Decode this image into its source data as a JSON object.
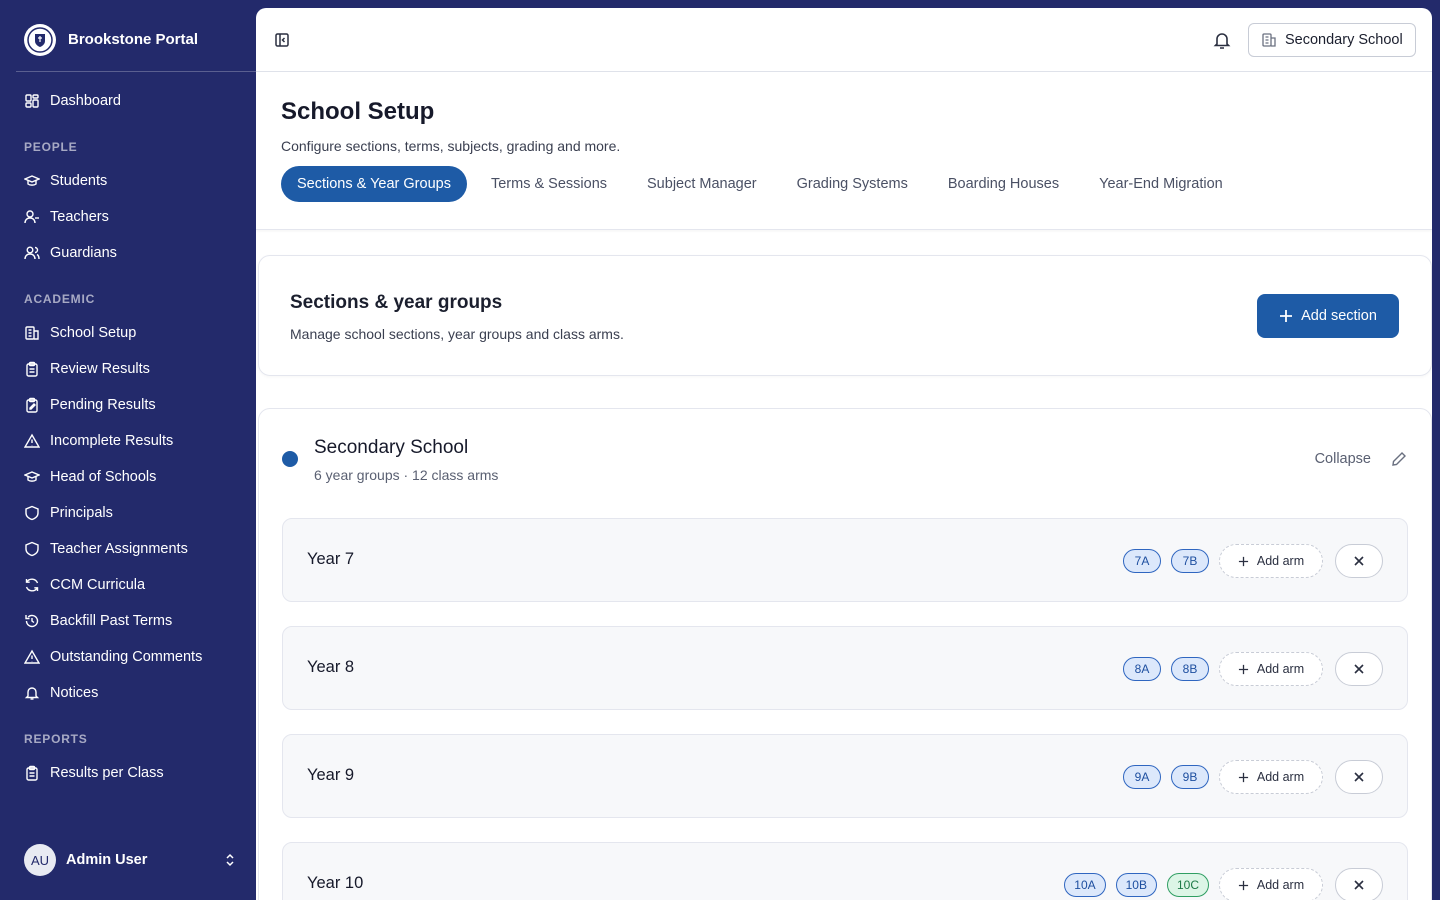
{
  "brand": {
    "name": "Brookstone Portal"
  },
  "sidebar": {
    "top": [
      {
        "label": "Dashboard",
        "icon": "dashboard-icon"
      }
    ],
    "groups": [
      {
        "title": "PEOPLE",
        "items": [
          {
            "label": "Students",
            "icon": "graduation-cap-icon"
          },
          {
            "label": "Teachers",
            "icon": "user-icon"
          },
          {
            "label": "Guardians",
            "icon": "users-icon"
          }
        ]
      },
      {
        "title": "ACADEMIC",
        "items": [
          {
            "label": "School Setup",
            "icon": "building-icon"
          },
          {
            "label": "Review Results",
            "icon": "clipboard-icon"
          },
          {
            "label": "Pending Results",
            "icon": "clipboard-edit-icon"
          },
          {
            "label": "Incomplete Results",
            "icon": "warning-icon"
          },
          {
            "label": "Head of Schools",
            "icon": "graduation-cap-icon"
          },
          {
            "label": "Principals",
            "icon": "shield-icon"
          },
          {
            "label": "Teacher Assignments",
            "icon": "shield-icon"
          },
          {
            "label": "CCM Curricula",
            "icon": "refresh-icon"
          },
          {
            "label": "Backfill Past Terms",
            "icon": "history-icon"
          },
          {
            "label": "Outstanding Comments",
            "icon": "warning-icon"
          },
          {
            "label": "Notices",
            "icon": "bell-icon"
          }
        ]
      },
      {
        "title": "REPORTS",
        "items": [
          {
            "label": "Results per Class",
            "icon": "clipboard-icon"
          }
        ]
      }
    ],
    "user": {
      "initials": "AU",
      "name": "Admin User"
    }
  },
  "topbar": {
    "school_selector": "Secondary School"
  },
  "page": {
    "title": "School Setup",
    "subtitle": "Configure sections, terms, subjects, grading and more.",
    "tabs": [
      {
        "label": "Sections & Year Groups",
        "active": true
      },
      {
        "label": "Terms & Sessions",
        "active": false
      },
      {
        "label": "Subject Manager",
        "active": false
      },
      {
        "label": "Grading Systems",
        "active": false
      },
      {
        "label": "Boarding Houses",
        "active": false
      },
      {
        "label": "Year-End Migration",
        "active": false
      }
    ]
  },
  "sections_card": {
    "title": "Sections & year groups",
    "subtitle": "Manage school sections, year groups and class arms.",
    "add_button": "Add section"
  },
  "section": {
    "name": "Secondary School",
    "meta": "6 year groups · 12 class arms",
    "collapse_label": "Collapse",
    "accent": "#1e5ba6",
    "add_arm_label": "Add arm",
    "years": [
      {
        "label": "Year 7",
        "arms": [
          {
            "name": "7A",
            "color": "blue"
          },
          {
            "name": "7B",
            "color": "blue"
          }
        ]
      },
      {
        "label": "Year 8",
        "arms": [
          {
            "name": "8A",
            "color": "blue"
          },
          {
            "name": "8B",
            "color": "blue"
          }
        ]
      },
      {
        "label": "Year 9",
        "arms": [
          {
            "name": "9A",
            "color": "blue"
          },
          {
            "name": "9B",
            "color": "blue"
          }
        ]
      },
      {
        "label": "Year 10",
        "arms": [
          {
            "name": "10A",
            "color": "blue"
          },
          {
            "name": "10B",
            "color": "blue"
          },
          {
            "name": "10C",
            "color": "green"
          }
        ]
      }
    ]
  }
}
